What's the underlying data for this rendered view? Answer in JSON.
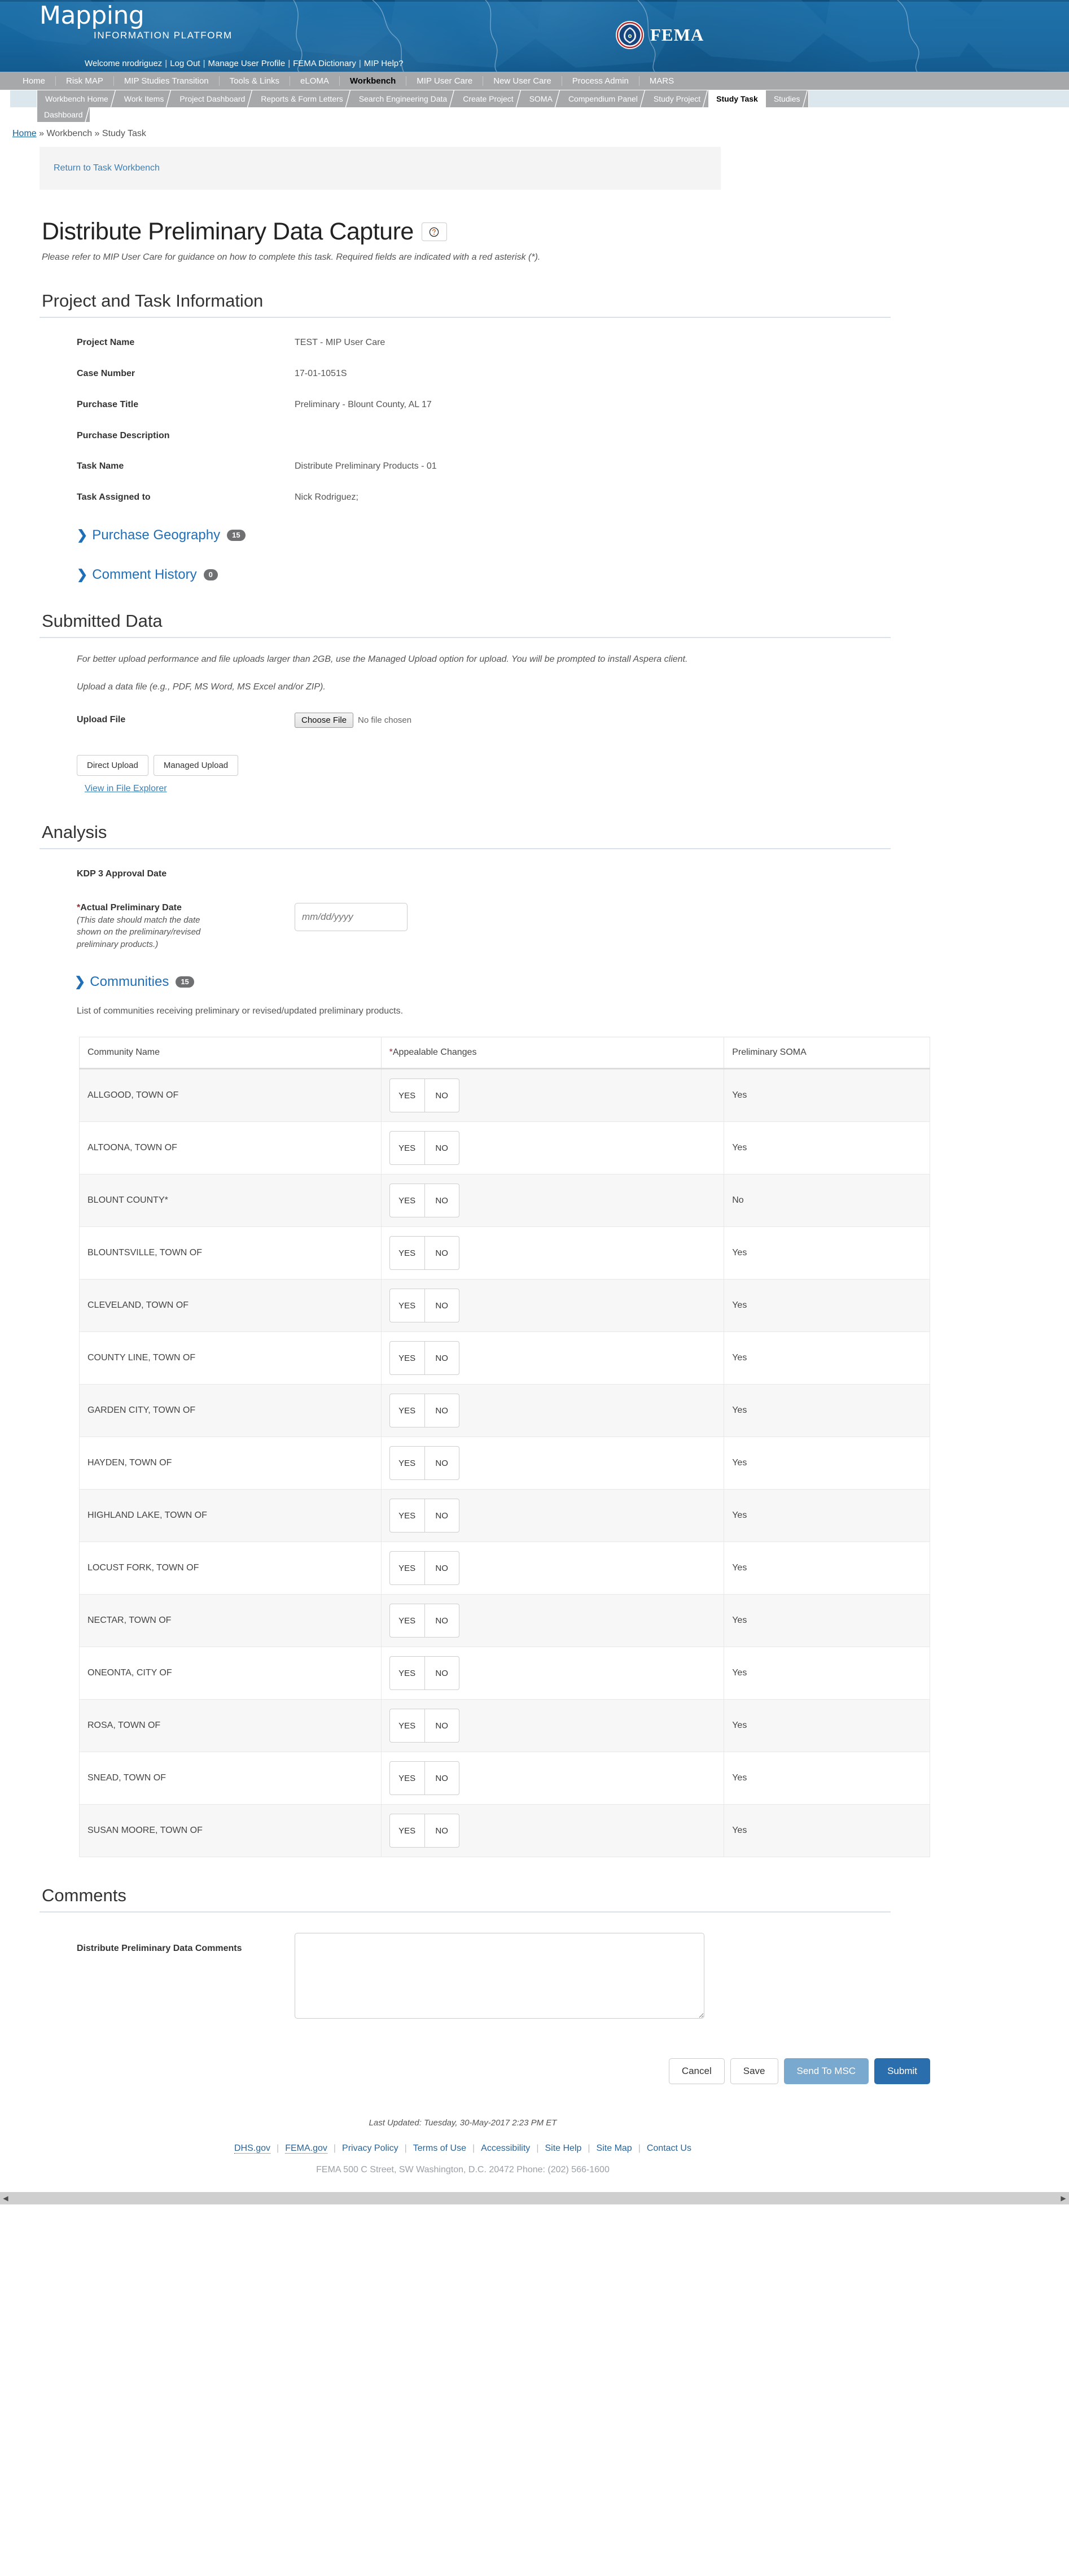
{
  "banner": {
    "brand_main": "Mapping",
    "brand_sub": "INFORMATION PLATFORM",
    "agency_name": "FEMA",
    "utility_links": [
      "Welcome nrodriguez",
      "Log Out",
      "Manage User Profile",
      "FEMA Dictionary",
      "MIP Help?"
    ]
  },
  "nav_primary": [
    {
      "label": "Home",
      "active": false
    },
    {
      "label": "Risk MAP",
      "active": false
    },
    {
      "label": "MIP Studies Transition",
      "active": false
    },
    {
      "label": "Tools & Links",
      "active": false
    },
    {
      "label": "eLOMA",
      "active": false
    },
    {
      "label": "Workbench",
      "active": true
    },
    {
      "label": "MIP User Care",
      "active": false
    },
    {
      "label": "New User Care",
      "active": false
    },
    {
      "label": "Process Admin",
      "active": false
    },
    {
      "label": "MARS",
      "active": false
    }
  ],
  "nav_secondary": [
    {
      "label": "Workbench Home",
      "active": false
    },
    {
      "label": "Work Items",
      "active": false
    },
    {
      "label": "Project Dashboard",
      "active": false
    },
    {
      "label": "Reports & Form Letters",
      "active": false
    },
    {
      "label": "Search Engineering Data",
      "active": false
    },
    {
      "label": "Create Project",
      "active": false
    },
    {
      "label": "SOMA",
      "active": false
    },
    {
      "label": "Compendium Panel",
      "active": false
    },
    {
      "label": "Study Project",
      "active": false
    },
    {
      "label": "Study Task",
      "active": true
    },
    {
      "label": "Studies",
      "active": false
    }
  ],
  "nav_third": [
    {
      "label": "Dashboard"
    }
  ],
  "breadcrumb": {
    "home": "Home",
    "trail": " » Workbench » Study Task"
  },
  "return_bar": {
    "link": "Return to Task Workbench"
  },
  "page": {
    "title": "Distribute Preliminary Data Capture",
    "help_icon": "question-mark-circle-icon",
    "subtitle": "Please refer to MIP User Care for guidance on how to complete this task. Required fields are indicated with a red asterisk (*)."
  },
  "project_info": {
    "heading": "Project and Task Information",
    "fields": [
      {
        "label": "Project Name",
        "value": "TEST - MIP User Care"
      },
      {
        "label": "Case Number",
        "value": "17-01-1051S"
      },
      {
        "label": "Purchase Title",
        "value": "Preliminary - Blount County, AL 17"
      },
      {
        "label": "Purchase Description",
        "value": ""
      },
      {
        "label": "Task Name",
        "value": "Distribute Preliminary Products - 01"
      },
      {
        "label": "Task Assigned to",
        "value": "Nick Rodriguez;"
      }
    ]
  },
  "disclosures": {
    "purchase_geography": {
      "label": "Purchase Geography",
      "count": "15"
    },
    "comment_history": {
      "label": "Comment History",
      "count": "0"
    },
    "communities": {
      "label": "Communities",
      "count": "15"
    }
  },
  "submitted_data": {
    "heading": "Submitted Data",
    "note1": "For better upload performance and file uploads larger than 2GB, use the Managed Upload option for upload. You will be prompted to install Aspera client.",
    "note2": "Upload a data file (e.g., PDF, MS Word, MS Excel and/or ZIP).",
    "upload_label": "Upload File",
    "choose_file_label": "Choose File",
    "no_file_text": "No file chosen",
    "direct_upload_label": "Direct Upload",
    "managed_upload_label": "Managed Upload",
    "file_explorer_link": "View in File Explorer"
  },
  "analysis": {
    "heading": "Analysis",
    "kdp_label": "KDP 3 Approval Date",
    "kdp_value": "",
    "actual_prelim_label": "Actual Preliminary Date",
    "actual_prelim_required_mark": "*",
    "actual_prelim_help": "(This date should match the date shown on the preliminary/revised preliminary products.)",
    "date_placeholder": "mm/dd/yyyy",
    "date_value": ""
  },
  "communities_section": {
    "description": "List of communities receiving preliminary or revised/updated preliminary products.",
    "columns": [
      "Community Name",
      "*Appealable Changes",
      "Preliminary SOMA"
    ],
    "appealable_required_mark": "*",
    "appealable_header_text": "Appealable Changes",
    "yes_label": "YES",
    "no_label": "NO",
    "rows": [
      {
        "name": "ALLGOOD, TOWN OF",
        "appealable": "",
        "soma": "Yes"
      },
      {
        "name": "ALTOONA, TOWN OF",
        "appealable": "",
        "soma": "Yes"
      },
      {
        "name": "BLOUNT COUNTY*",
        "appealable": "",
        "soma": "No"
      },
      {
        "name": "BLOUNTSVILLE, TOWN OF",
        "appealable": "",
        "soma": "Yes"
      },
      {
        "name": "CLEVELAND, TOWN OF",
        "appealable": "",
        "soma": "Yes"
      },
      {
        "name": "COUNTY LINE, TOWN OF",
        "appealable": "",
        "soma": "Yes"
      },
      {
        "name": "GARDEN CITY, TOWN OF",
        "appealable": "",
        "soma": "Yes"
      },
      {
        "name": "HAYDEN, TOWN OF",
        "appealable": "",
        "soma": "Yes"
      },
      {
        "name": "HIGHLAND LAKE, TOWN OF",
        "appealable": "",
        "soma": "Yes"
      },
      {
        "name": "LOCUST FORK, TOWN OF",
        "appealable": "",
        "soma": "Yes"
      },
      {
        "name": "NECTAR, TOWN OF",
        "appealable": "",
        "soma": "Yes"
      },
      {
        "name": "ONEONTA, CITY OF",
        "appealable": "",
        "soma": "Yes"
      },
      {
        "name": "ROSA, TOWN OF",
        "appealable": "",
        "soma": "Yes"
      },
      {
        "name": "SNEAD, TOWN OF",
        "appealable": "",
        "soma": "Yes"
      },
      {
        "name": "SUSAN MOORE, TOWN OF",
        "appealable": "",
        "soma": "Yes"
      }
    ]
  },
  "comments": {
    "heading": "Comments",
    "label": "Distribute Preliminary Data Comments",
    "value": ""
  },
  "actions": {
    "cancel": "Cancel",
    "save": "Save",
    "send_to_msc": "Send To MSC",
    "submit": "Submit"
  },
  "footer": {
    "last_updated": "Last Updated: Tuesday, 30-May-2017 2:23 PM ET",
    "links": [
      "DHS.gov",
      "FEMA.gov",
      "Privacy Policy",
      "Terms of Use",
      "Accessibility",
      "Site Help",
      "Site Map",
      "Contact Us"
    ],
    "address": "FEMA 500 C Street, SW Washington, D.C. 20472 Phone: (202) 566-1600",
    "address_acronym": "FEMA"
  },
  "colors": {
    "banner_blue": "#16659e",
    "nav_gray": "#a6a8aa",
    "link_blue": "#2a6496",
    "accent_blue": "#1f6fb8",
    "primary_button": "#2a6eae",
    "secondary_button": "#7aa9d0",
    "required_red": "#a3282d",
    "badge_gray": "#6f7072"
  }
}
